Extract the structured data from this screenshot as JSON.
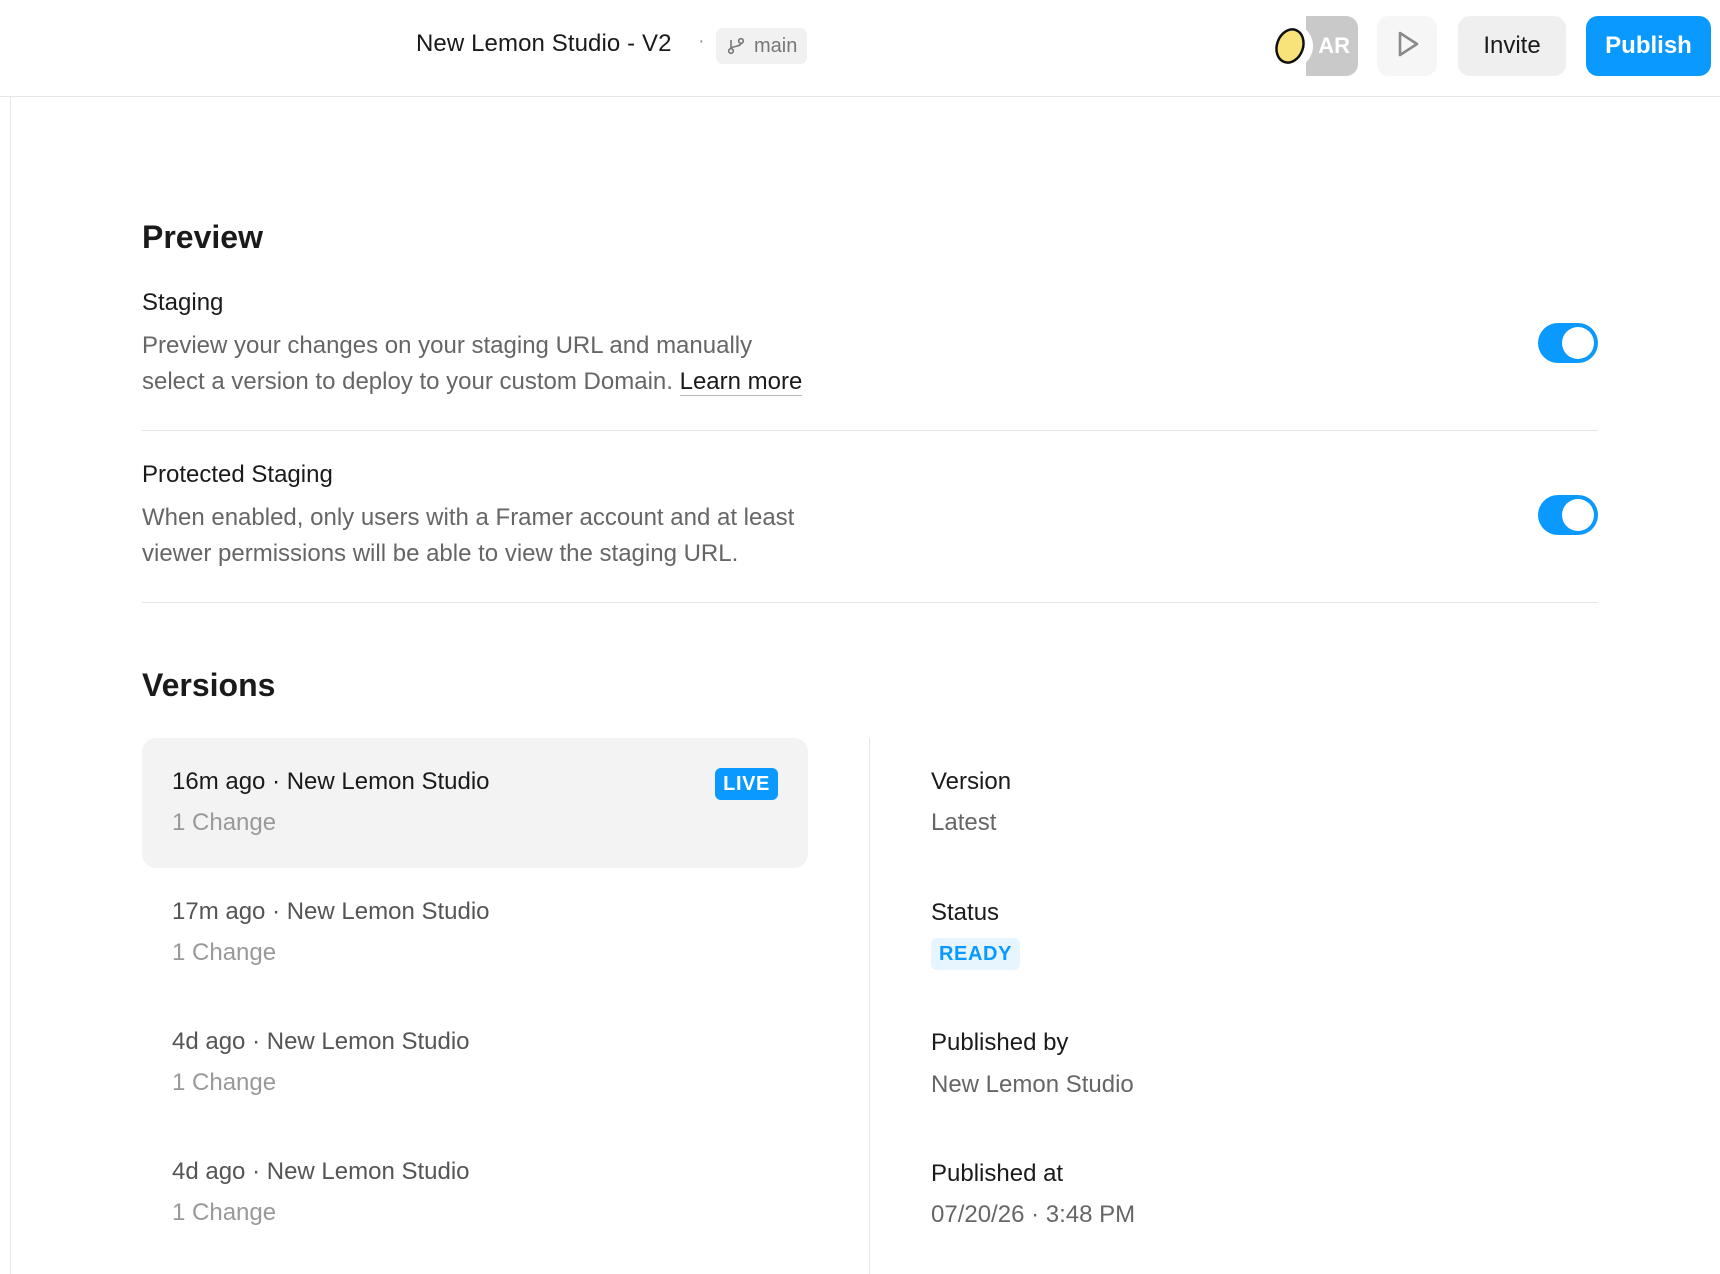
{
  "header": {
    "project_title": "New Lemon Studio - V2",
    "separator": "·",
    "branch": "main",
    "avatar_initials": "AR",
    "invite_label": "Invite",
    "publish_label": "Publish"
  },
  "preview": {
    "section_title": "Preview",
    "staging": {
      "title": "Staging",
      "description_line1": "Preview your changes on your staging URL and manually",
      "description_line2": "select a version to deploy to your custom Domain.",
      "link_label": "Learn more",
      "enabled": true
    },
    "protected_staging": {
      "title": "Protected Staging",
      "description_line1": "When enabled, only users with a Framer account and at least",
      "description_line2": "viewer permissions will be able to view the staging URL.",
      "enabled": true
    }
  },
  "versions": {
    "section_title": "Versions",
    "items": [
      {
        "heading": "16m ago · New Lemon Studio",
        "changes": "1 Change",
        "badge": "LIVE",
        "selected": true
      },
      {
        "heading": "17m ago · New Lemon Studio",
        "changes": "1 Change",
        "badge": "",
        "selected": false
      },
      {
        "heading": "4d ago · New Lemon Studio",
        "changes": "1 Change",
        "badge": "",
        "selected": false
      },
      {
        "heading": "4d ago · New Lemon Studio",
        "changes": "1 Change",
        "badge": "",
        "selected": false
      }
    ],
    "details": {
      "version_label": "Version",
      "version_value": "Latest",
      "status_label": "Status",
      "status_value": "READY",
      "published_by_label": "Published by",
      "published_by_value": "New Lemon Studio",
      "published_at_label": "Published at",
      "published_at_value": "07/20/26 · 3:48 PM"
    }
  },
  "colors": {
    "accent": "#0a99ff",
    "ready_badge_bg": "#e6f5ff",
    "lemon": "#f7e37a"
  },
  "icons": [
    "branch-icon",
    "lemon-avatar-icon",
    "play-icon"
  ]
}
